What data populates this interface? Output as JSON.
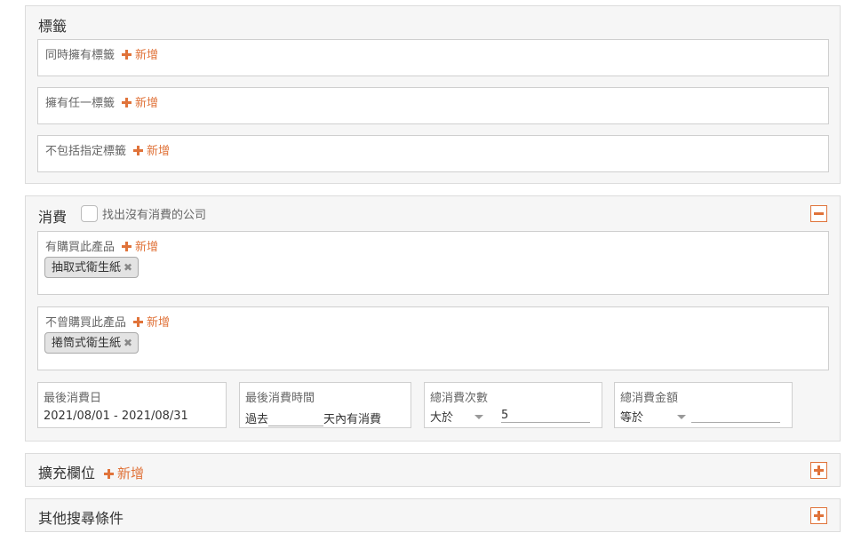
{
  "tags": {
    "title": "標籤",
    "boxes": [
      {
        "label": "同時擁有標籤",
        "add": "新增"
      },
      {
        "label": "擁有任一標籤",
        "add": "新增"
      },
      {
        "label": "不包括指定標籤",
        "add": "新增"
      }
    ]
  },
  "consumption": {
    "title": "消費",
    "checkbox_label": "找出沒有消費的公司",
    "bought": {
      "label": "有購買此產品",
      "add": "新增",
      "chip": "抽取式衛生紙"
    },
    "never_bought": {
      "label": "不曾購買此產品",
      "add": "新增",
      "chip": "捲筒式衛生紙"
    },
    "last_date": {
      "label": "最後消費日",
      "value": "2021/08/01 - 2021/08/31"
    },
    "last_time": {
      "label": "最後消費時間",
      "prefix": "過去",
      "value": "",
      "suffix": "天內有消費"
    },
    "count": {
      "label": "總消費次數",
      "operator": "大於",
      "value": "5"
    },
    "amount": {
      "label": "總消費金額",
      "operator": "等於",
      "value": ""
    }
  },
  "extend": {
    "title": "擴充欄位",
    "add": "新增"
  },
  "other": {
    "title": "其他搜尋條件"
  },
  "colors": {
    "accent": "#e0733a",
    "panel_bg": "#f6f6f6",
    "border": "#cfcfcf"
  },
  "icons": {
    "add": "plus-icon",
    "remove": "close-icon",
    "collapse": "minus-icon",
    "expand": "plus-icon",
    "dropdown": "caret-down-icon"
  }
}
